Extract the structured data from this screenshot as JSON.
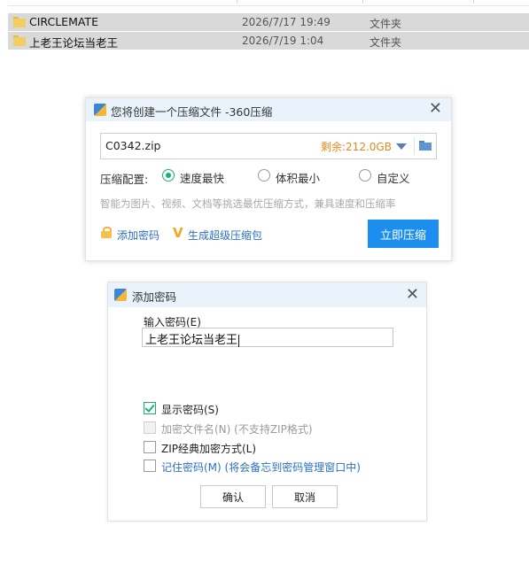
{
  "file_list": {
    "rows": [
      {
        "name": "CIRCLEMATE",
        "date": "2026/7/17 19:49",
        "type": "文件夹"
      },
      {
        "name": "上老王论坛当老王",
        "date": "2026/7/19 1:04",
        "type": "文件夹"
      }
    ]
  },
  "compress_dialog": {
    "title": "您将创建一个压缩文件 -360压缩",
    "close_icon": "close-icon",
    "filename": "C0342.zip",
    "free_space": "剩余:212.0GB",
    "config_label": "压缩配置:",
    "options": [
      {
        "label": "速度最快",
        "selected": true
      },
      {
        "label": "体积最小",
        "selected": false
      },
      {
        "label": "自定义",
        "selected": false
      }
    ],
    "hint": "智能为图片、视频、文档等挑选最优压缩方式，兼具速度和压缩率",
    "add_password_link": "添加密码",
    "super_link": "生成超级压缩包",
    "compress_button": "立即压缩",
    "colors": {
      "accent": "#1b8ef0",
      "radio": "#1ab16b",
      "free_space": "#e28a1a"
    }
  },
  "password_dialog": {
    "title": "添加密码",
    "input_label": "输入密码(E)",
    "input_value": "上老王论坛当老王",
    "checkboxes": [
      {
        "label": "显示密码(S)",
        "checked": true,
        "disabled": false
      },
      {
        "label": "加密文件名(N) (不支持ZIP格式)",
        "checked": false,
        "disabled": true
      },
      {
        "label": "ZIP经典加密方式(L)",
        "checked": false,
        "disabled": false
      },
      {
        "label": "记住密码(M) (将会备忘到密码管理窗口中)",
        "checked": false,
        "disabled": false
      }
    ],
    "ok_button": "确认",
    "cancel_button": "取消"
  }
}
